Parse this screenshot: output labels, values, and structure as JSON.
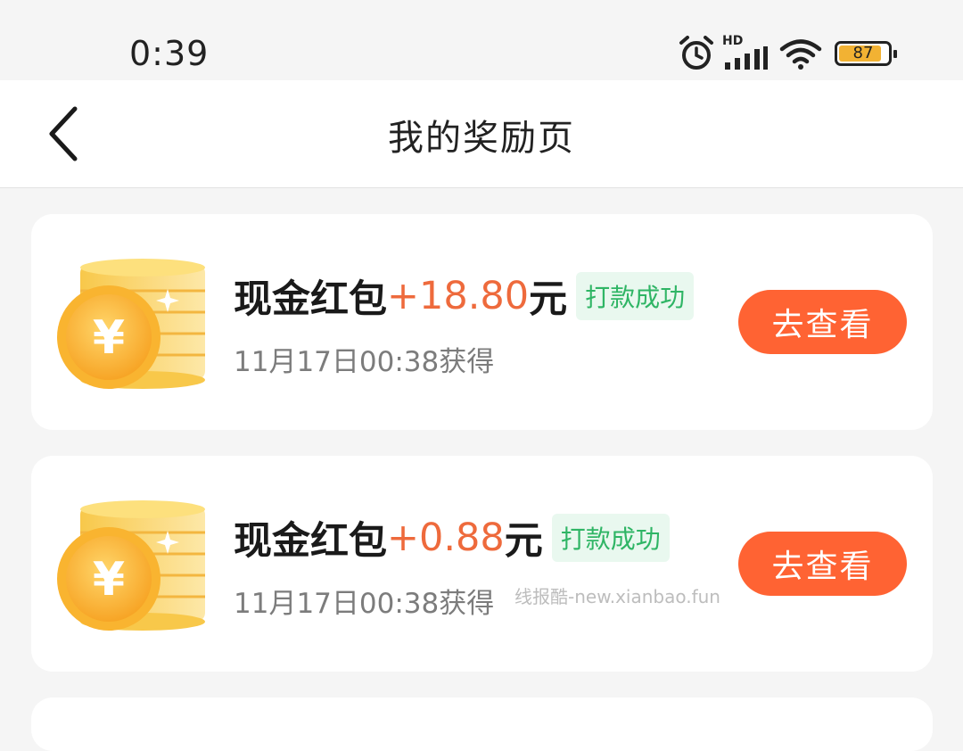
{
  "status_bar": {
    "time": "0:39",
    "network": "HD",
    "battery": "87",
    "icons": [
      "alarm-icon",
      "signal-icon",
      "wifi-icon",
      "battery-icon"
    ]
  },
  "nav": {
    "back_icon": "chevron-left-icon",
    "title": "我的奖励页"
  },
  "colors": {
    "accent": "#ff6333",
    "amount": "#ee6a3c",
    "success_text": "#2fb565",
    "success_bg": "#e9f8ef"
  },
  "rewards": [
    {
      "icon": "gold-coin-stack-icon",
      "title": "现金红包",
      "amount": "+18.80",
      "unit": "元",
      "status": "打款成功",
      "time": "11月17日00:38获得",
      "button": "去查看"
    },
    {
      "icon": "gold-coin-stack-icon",
      "title": "现金红包",
      "amount": "+0.88",
      "unit": "元",
      "status": "打款成功",
      "time": "11月17日00:38获得",
      "button": "去查看"
    }
  ],
  "watermark": "线报酷-new.xianbao.fun"
}
